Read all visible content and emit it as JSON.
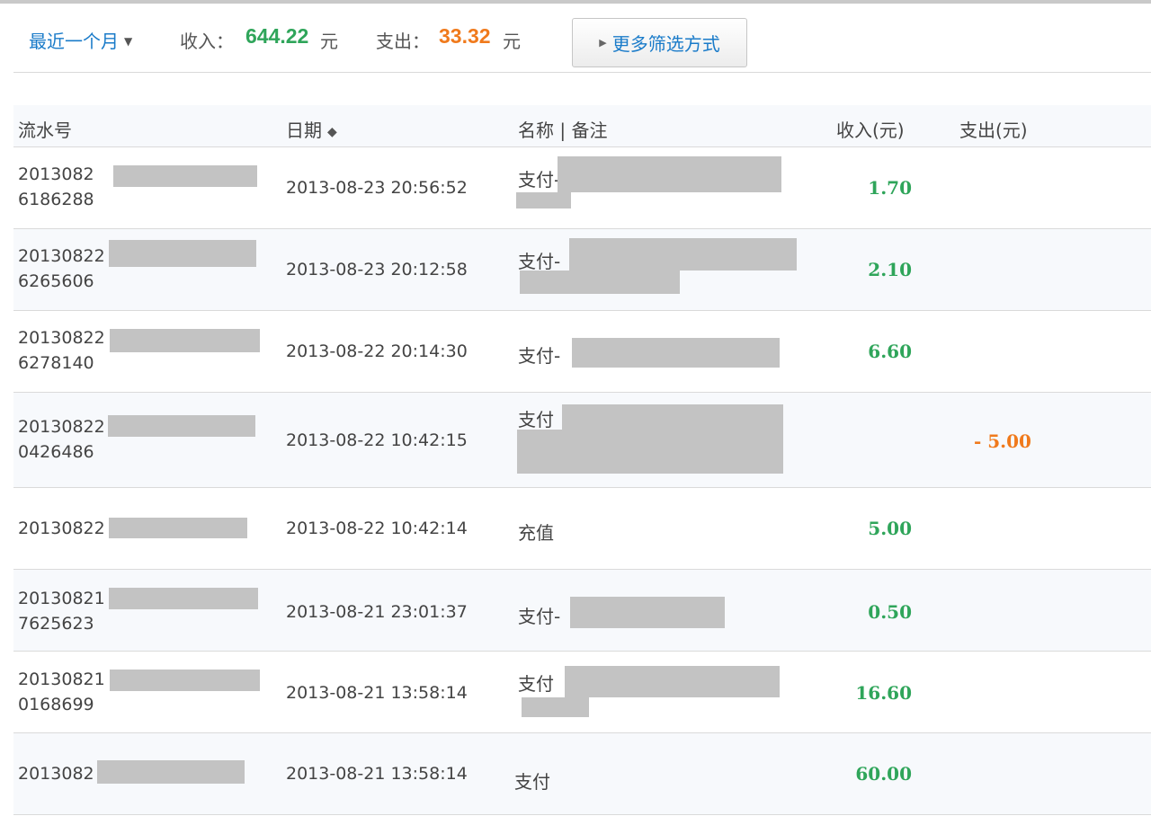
{
  "filter": {
    "period_label": "最近一个月",
    "income_label": "收入：",
    "income_value": "644.22",
    "expense_label": "支出：",
    "expense_value": "33.32",
    "unit": "元",
    "more_filters_label": "更多筛选方式"
  },
  "table": {
    "headers": {
      "serial": "流水号",
      "date": "日期",
      "name": "名称 | 备注",
      "income": "收入(元)",
      "expense": "支出(元)"
    },
    "rows": [
      {
        "serial_line1": "2013082",
        "serial_line2": "6186288",
        "date": "2013-08-23 20:56:52",
        "name": "支付-",
        "income": "1.70",
        "expense": ""
      },
      {
        "serial_line1": "20130822",
        "serial_line2": "6265606",
        "date": "2013-08-23 20:12:58",
        "name": "支付-",
        "income": "2.10",
        "expense": ""
      },
      {
        "serial_line1": "20130822",
        "serial_line2": "6278140",
        "date": "2013-08-22 20:14:30",
        "name": "支付-",
        "income": "6.60",
        "expense": ""
      },
      {
        "serial_line1": "20130822",
        "serial_line2": "0426486",
        "date": "2013-08-22 10:42:15",
        "name": "支付",
        "income": "",
        "expense": "- 5.00"
      },
      {
        "serial_line1": "20130822",
        "serial_line2": "",
        "date": "2013-08-22 10:42:14",
        "name": "充值",
        "income": "5.00",
        "expense": ""
      },
      {
        "serial_line1": "20130821",
        "serial_line2": "7625623",
        "date": "2013-08-21 23:01:37",
        "name": "支付-",
        "income": "0.50",
        "expense": ""
      },
      {
        "serial_line1": "20130821",
        "serial_line2": "0168699",
        "date": "2013-08-21 13:58:14",
        "name": "支付",
        "income": "16.60",
        "expense": ""
      },
      {
        "serial_line1": "2013082",
        "serial_line2": "",
        "date": "2013-08-21 13:58:14",
        "name": "支付",
        "income": "60.00",
        "expense": ""
      }
    ]
  }
}
